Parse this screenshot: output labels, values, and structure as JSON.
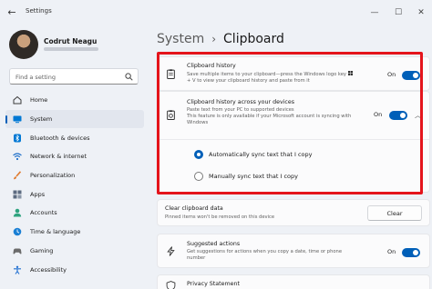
{
  "window": {
    "title": "Settings",
    "back": "←",
    "minimize": "—",
    "maximize": "☐",
    "close": "✕"
  },
  "user": {
    "name": "Codrut Neagu"
  },
  "search": {
    "placeholder": "Find a setting"
  },
  "nav": [
    {
      "label": "Home",
      "icon": "home-icon",
      "color": "#3a3a3a"
    },
    {
      "label": "System",
      "icon": "system-icon",
      "color": "#0078d4",
      "active": true
    },
    {
      "label": "Bluetooth & devices",
      "icon": "bluetooth-icon",
      "color": "#0078d4"
    },
    {
      "label": "Network & internet",
      "icon": "wifi-icon",
      "color": "#1e6fc9"
    },
    {
      "label": "Personalization",
      "icon": "brush-icon",
      "color": "#e07b2f"
    },
    {
      "label": "Apps",
      "icon": "apps-icon",
      "color": "#5c6b80"
    },
    {
      "label": "Accounts",
      "icon": "accounts-icon",
      "color": "#2ea37f"
    },
    {
      "label": "Time & language",
      "icon": "time-language-icon",
      "color": "#1a7fd4"
    },
    {
      "label": "Gaming",
      "icon": "gaming-icon",
      "color": "#6b6b6b"
    },
    {
      "label": "Accessibility",
      "icon": "accessibility-icon",
      "color": "#1f6fd1"
    }
  ],
  "breadcrumb": {
    "root": "System",
    "separator": "›",
    "page": "Clipboard"
  },
  "clipboard_history": {
    "title": "Clipboard history",
    "desc_line1": "Save multiple items to your clipboard—press the Windows logo key",
    "desc_line2": "+ V to view your clipboard history and paste from it",
    "state": "On"
  },
  "sync": {
    "title": "Clipboard history across your devices",
    "desc_line1": "Paste text from your PC to supported devices",
    "desc_line2": "This feature is only available if your Microsoft account is syncing with",
    "desc_line3": "Windows",
    "state": "On",
    "option_auto": "Automatically sync text that I copy",
    "option_manual": "Manually sync text that I copy"
  },
  "clear": {
    "title": "Clear clipboard data",
    "desc": "Pinned items won't be removed on this device",
    "button": "Clear"
  },
  "suggested": {
    "title": "Suggested actions",
    "desc_line1": "Get suggestions for actions when you copy a date, time or phone",
    "desc_line2": "number",
    "state": "On"
  },
  "privacy": {
    "title": "Privacy Statement"
  },
  "colors": {
    "accent": "#005fb8",
    "highlight": "#e4141b",
    "background": "#eef1f6",
    "card": "#fbfbfc"
  }
}
